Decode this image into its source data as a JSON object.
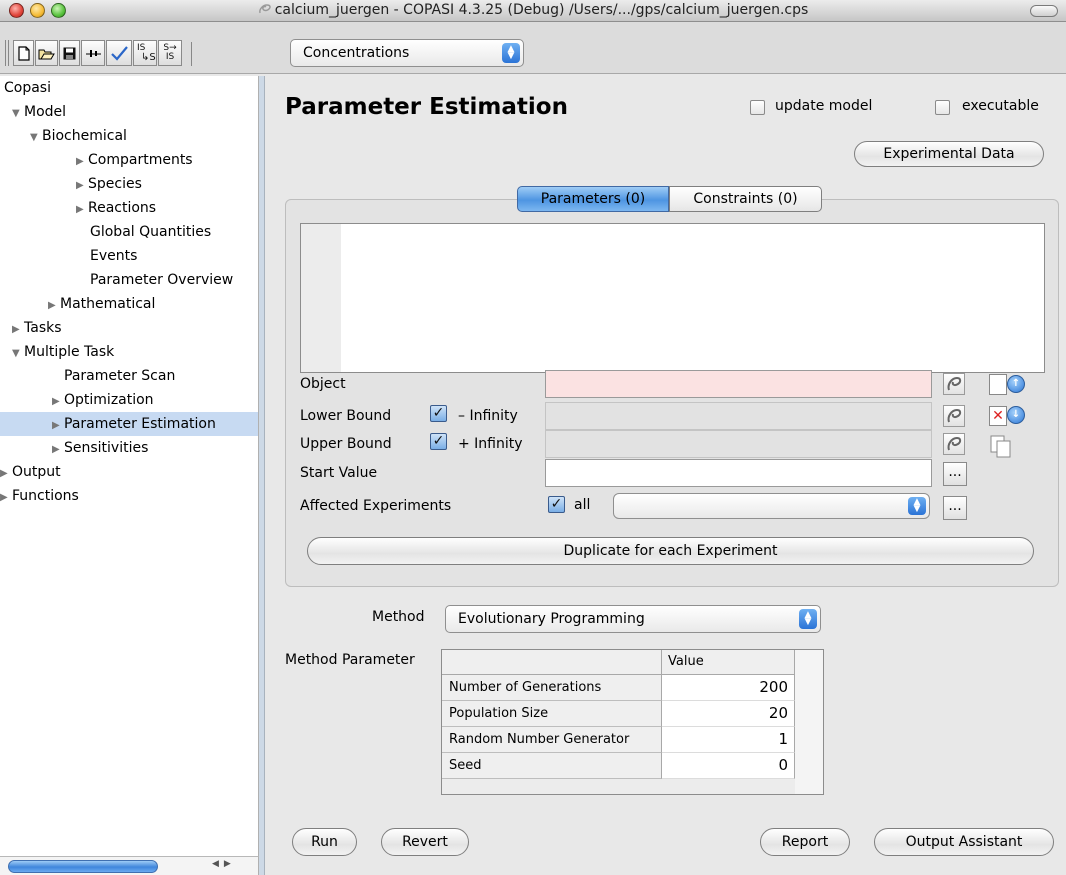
{
  "window": {
    "title": "calcium_juergen - COPASI 4.3.25 (Debug) /Users/.../gps/calcium_juergen.cps"
  },
  "toolbar": {
    "buttons": [
      "new-file-icon",
      "open-folder-icon",
      "save-icon",
      "slider-icon",
      "check-icon",
      "is-to-s-icon",
      "s-to-is-icon"
    ],
    "is_s_text": "IS",
    "is_s_sub": "S",
    "s_is_top": "S",
    "s_is_bottom": "IS",
    "mode_select": "Concentrations"
  },
  "tree": {
    "root": "Copasi",
    "items": [
      {
        "label": "Model",
        "arrow": "▼"
      },
      {
        "label": "Biochemical",
        "arrow": "▼"
      },
      {
        "label": "Compartments",
        "arrow": "▶"
      },
      {
        "label": "Species",
        "arrow": "▶"
      },
      {
        "label": "Reactions",
        "arrow": "▶"
      },
      {
        "label": "Global Quantities",
        "arrow": ""
      },
      {
        "label": "Events",
        "arrow": ""
      },
      {
        "label": "Parameter Overview",
        "arrow": ""
      },
      {
        "label": "Mathematical",
        "arrow": "▶"
      },
      {
        "label": "Tasks",
        "arrow": "▶"
      },
      {
        "label": "Multiple Task",
        "arrow": "▼"
      },
      {
        "label": "Parameter Scan",
        "arrow": ""
      },
      {
        "label": "Optimization",
        "arrow": "▶"
      },
      {
        "label": "Parameter Estimation",
        "arrow": "▶"
      },
      {
        "label": "Sensitivities",
        "arrow": "▶"
      },
      {
        "label": "Output",
        "arrow": "▶"
      },
      {
        "label": "Functions",
        "arrow": "▶"
      }
    ],
    "selected": "Parameter Estimation"
  },
  "main": {
    "heading": "Parameter Estimation",
    "update_model": {
      "label": "update model",
      "checked": false
    },
    "executable": {
      "label": "executable",
      "checked": false
    },
    "experimental_data_button": "Experimental Data",
    "tabs": [
      {
        "label": "Parameters (0)",
        "active": true
      },
      {
        "label": "Constraints (0)",
        "active": false
      }
    ],
    "fields": {
      "object_label": "Object",
      "object_value": "",
      "lower_bound_label": "Lower Bound",
      "lower_infinity_label": "– Infinity",
      "lower_infinity_checked": true,
      "upper_bound_label": "Upper Bound",
      "upper_infinity_label": "+ Infinity",
      "upper_infinity_checked": true,
      "start_value_label": "Start Value",
      "start_value": "",
      "affected_label": "Affected Experiments",
      "affected_all_label": "all",
      "affected_all_checked": true,
      "affected_select": "",
      "ellipsis": "..."
    },
    "duplicate_button": "Duplicate for each Experiment",
    "method_label": "Method",
    "method_select": "Evolutionary Programming",
    "method_parameter_label": "Method Parameter",
    "method_table": {
      "value_header": "Value",
      "rows": [
        {
          "name": "Number of Generations",
          "value": "200"
        },
        {
          "name": "Population Size",
          "value": "20"
        },
        {
          "name": "Random Number Generator",
          "value": "1"
        },
        {
          "name": "Seed",
          "value": "0"
        }
      ]
    },
    "buttons": {
      "run": "Run",
      "revert": "Revert",
      "report": "Report",
      "output_assistant": "Output Assistant"
    }
  }
}
